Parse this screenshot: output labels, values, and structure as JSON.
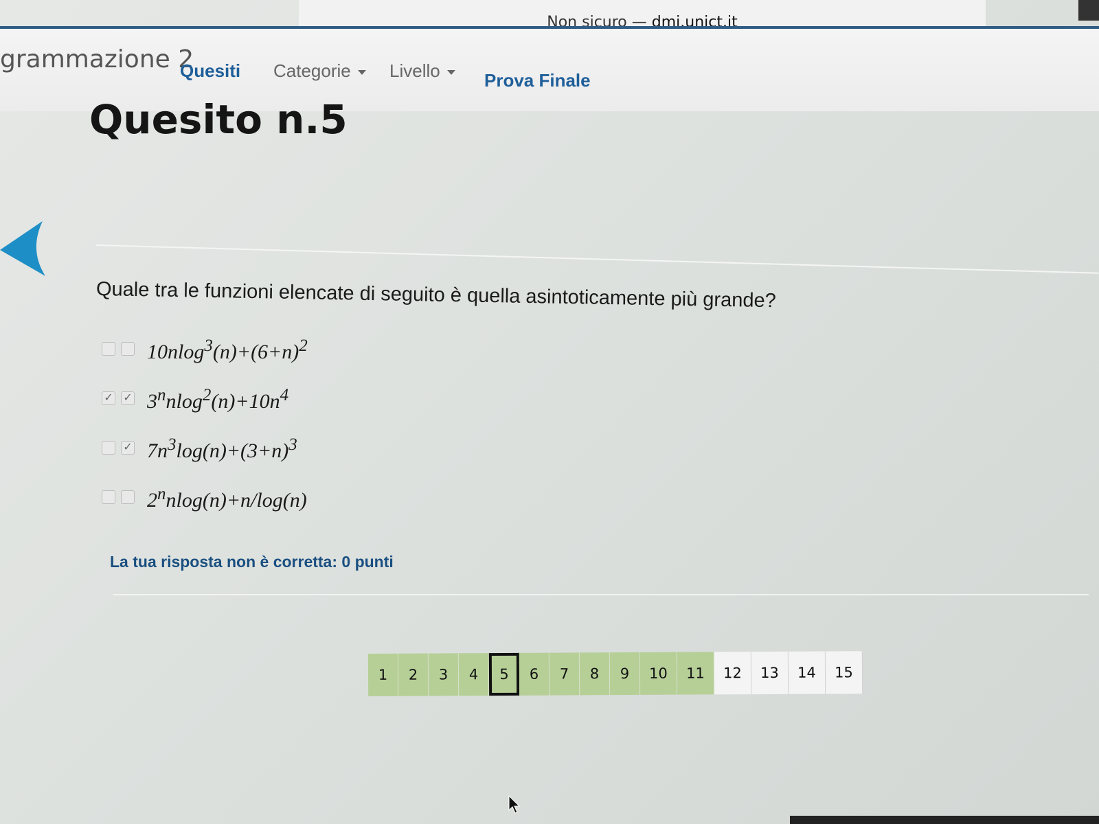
{
  "browser": {
    "security_label": "Non sicuro",
    "separator": "—",
    "domain": "dmi.unict.it"
  },
  "nav": {
    "brand": "grammazione 2",
    "quesiti": "Quesiti",
    "categorie": "Categorie",
    "livello": "Livello",
    "prova_finale": "Prova Finale"
  },
  "quiz": {
    "title": "Quesito n.5",
    "question": "Quale tra le funzioni elencate di seguito è quella asintoticamente più grande?",
    "answers": [
      {
        "formula_html": "10nlog<sup>3</sup>(n)+(6+n)<sup>2</sup>",
        "box1": false,
        "box2": false
      },
      {
        "formula_html": "3<sup>n</sup>nlog<sup>2</sup>(n)+10n<sup>4</sup>",
        "box1": true,
        "box2": true
      },
      {
        "formula_html": "7n<sup>3</sup>log(n)+(3+n)<sup>3</sup>",
        "box1": false,
        "box2": true
      },
      {
        "formula_html": "2<sup>n</sup>nlog(n)+n/log(n)",
        "box1": false,
        "box2": false
      }
    ],
    "feedback": "La tua risposta non è corretta: 0 punti"
  },
  "pager": {
    "pages": [
      "1",
      "2",
      "3",
      "4",
      "5",
      "6",
      "7",
      "8",
      "9",
      "10",
      "11",
      "12",
      "13",
      "14",
      "15"
    ],
    "current": "5",
    "answered_count": 11
  },
  "colors": {
    "accent": "#1f5f9a",
    "answered": "#b6cf97",
    "unanswered": "#f4f4f4",
    "back_arrow": "#1e8fc6"
  }
}
